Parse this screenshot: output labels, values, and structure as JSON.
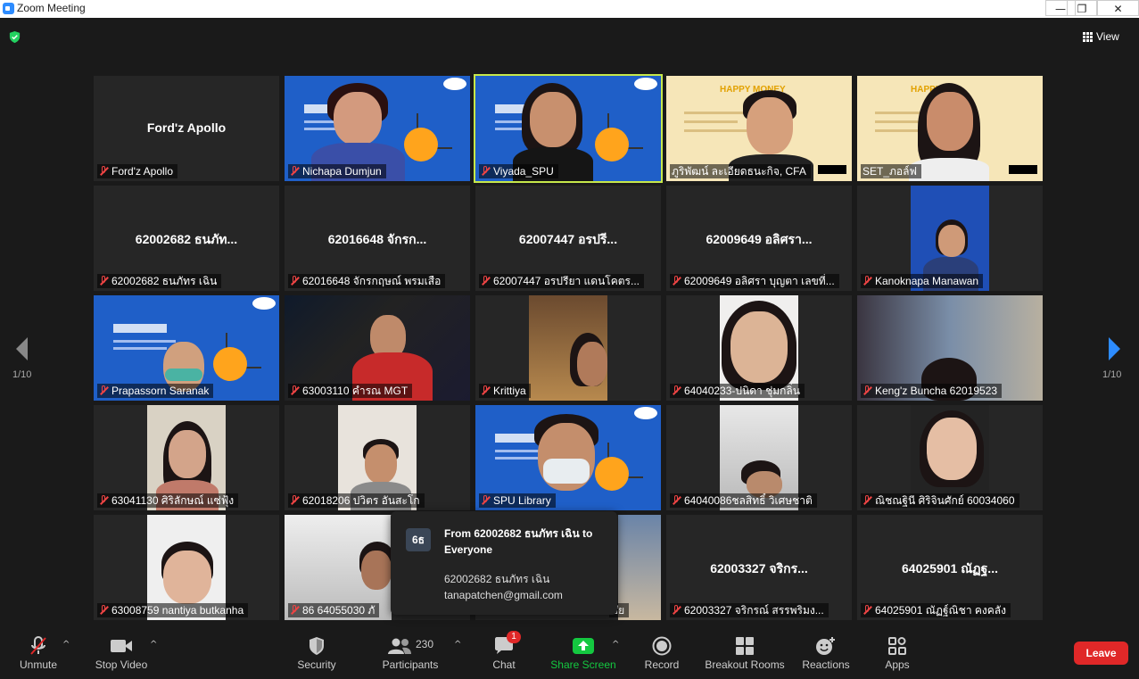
{
  "window": {
    "title": "Zoom Meeting",
    "minimize": "—",
    "restore": "❐",
    "close": "✕"
  },
  "view_label": "View",
  "pager": {
    "left": "1/10",
    "right": "1/10"
  },
  "tiles": [
    {
      "name": "Ford'z Apollo",
      "big": "Ford'z Apollo"
    },
    {
      "name": "Nichapa Dumjun"
    },
    {
      "name": "Viyada_SPU"
    },
    {
      "name": "ภูริพัฒน์ ละเอียดธนะกิจ, CFA"
    },
    {
      "name": "SET_ภอล์ฟ"
    },
    {
      "name": "62002682 ธนภัทร เฉิน",
      "big": "62002682 ธนภัท..."
    },
    {
      "name": "62016648 จักรกฤษณ์ พรมเสือ",
      "big": "62016648 จักรก..."
    },
    {
      "name": "62007447 อรปรียา แดนโคตร...",
      "big": "62007447 อรปรี..."
    },
    {
      "name": "62009649 อลิศรา บุญตา เลขที่...",
      "big": "62009649 อลิศรา..."
    },
    {
      "name": "Kanoknapa Manawan"
    },
    {
      "name": "Prapassorn Saranak"
    },
    {
      "name": "63003110 คำรณ  MGT"
    },
    {
      "name": "Krittiya"
    },
    {
      "name": "64040233-ปนิดา  ชุ่มกลิ่น"
    },
    {
      "name": "Keng'z Buncha 62019523"
    },
    {
      "name": "63041130 ศิริลักษณ์ แซ่ฟุ้ง"
    },
    {
      "name": "62018206 ปวิตร อันสะโก"
    },
    {
      "name": "SPU Library"
    },
    {
      "name": "64040086ชลสิทธิ์ วิเศษชาติ"
    },
    {
      "name": "ณิชณฐินี ศิริจินศักย์ 60034060"
    },
    {
      "name": "63008759 nantiya butkanha"
    },
    {
      "name": "86 64055030 ภั"
    },
    {
      "name": "ชัย"
    },
    {
      "name": "62003327 จริกรณ์ สรรพริมง...",
      "big": "62003327 จริกร..."
    },
    {
      "name": "64025901 ณัฏฐ์ณิชา คงคลัง",
      "big": "64025901 ณัฏฐ..."
    }
  ],
  "chat_popup": {
    "avatar": "6ธ",
    "from": "From 62002682 ธนภัทร เฉิน to Everyone",
    "line1": "62002682 ธนภัทร เฉิน",
    "line2": "tanapatchen@gmail.com"
  },
  "toolbar": {
    "unmute": "Unmute",
    "stop_video": "Stop Video",
    "security": "Security",
    "participants": "Participants",
    "participants_count": "230",
    "chat": "Chat",
    "chat_badge": "1",
    "share_screen": "Share Screen",
    "record": "Record",
    "breakout": "Breakout Rooms",
    "reactions": "Reactions",
    "apps": "Apps",
    "leave": "Leave"
  },
  "colors": {
    "share_green": "#14c840",
    "leave_red": "#e02828",
    "active_border": "#c7e84a"
  }
}
